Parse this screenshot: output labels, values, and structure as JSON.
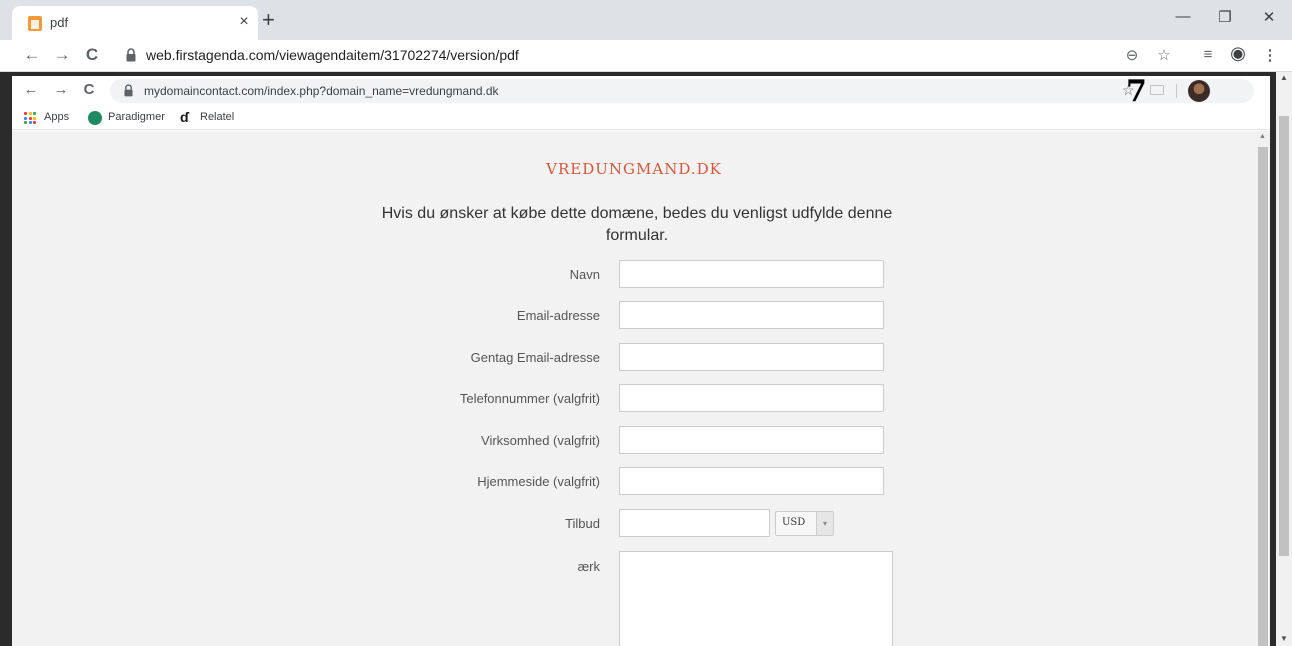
{
  "outer_browser": {
    "tab_title": "pdf",
    "tab_close": "×",
    "new_tab": "+",
    "url": "web.firstagenda.com/viewagendaitem/31702274/version/pdf",
    "icons": {
      "back": "←",
      "forward": "→",
      "reload": "C",
      "zoom": "⊖",
      "star": "☆",
      "reading_list": "≡",
      "profile": "◉",
      "menu": "⋮",
      "minimize": "—",
      "restore": "❐",
      "close": "✕"
    }
  },
  "pdf_viewer": {
    "page_number": "7"
  },
  "inner_browser": {
    "url": "mydomaincontact.com/index.php?domain_name=vredungmand.dk",
    "icons": {
      "back": "←",
      "forward": "→",
      "reload": "C",
      "star": "☆"
    },
    "bookmarks": [
      {
        "label": "Apps"
      },
      {
        "label": "Paradigmer"
      },
      {
        "label": "Relatel"
      }
    ],
    "apps_colors": [
      "#ea4335",
      "#fbbc04",
      "#34a853",
      "#4285f4",
      "#ea4335",
      "#fbbc04",
      "#34a853",
      "#4285f4",
      "#ea4335"
    ]
  },
  "form": {
    "domain_title": "VREDUNGMAND.DK",
    "intro": "Hvis du ønsker at købe dette domæne, bedes du venligst udfylde denne formular.",
    "fields": {
      "name": {
        "label": "Navn",
        "value": ""
      },
      "email": {
        "label": "Email-adresse",
        "value": ""
      },
      "email_repeat": {
        "label": "Gentag Email-adresse",
        "value": ""
      },
      "phone": {
        "label": "Telefonnummer (valgfrit)",
        "value": ""
      },
      "company": {
        "label": "Virksomhed (valgfrit)",
        "value": ""
      },
      "website": {
        "label": "Hjemmeside (valgfrit)",
        "value": ""
      },
      "offer": {
        "label": "Tilbud",
        "value": ""
      },
      "message": {
        "label": "ærk",
        "value": ""
      }
    },
    "currency": {
      "selected": "USD",
      "arrow": "▾"
    }
  },
  "colors": {
    "title_accent": "#d8573a",
    "content_background": "#f2f2f2",
    "pdf_frame": "#2b2b2b"
  }
}
